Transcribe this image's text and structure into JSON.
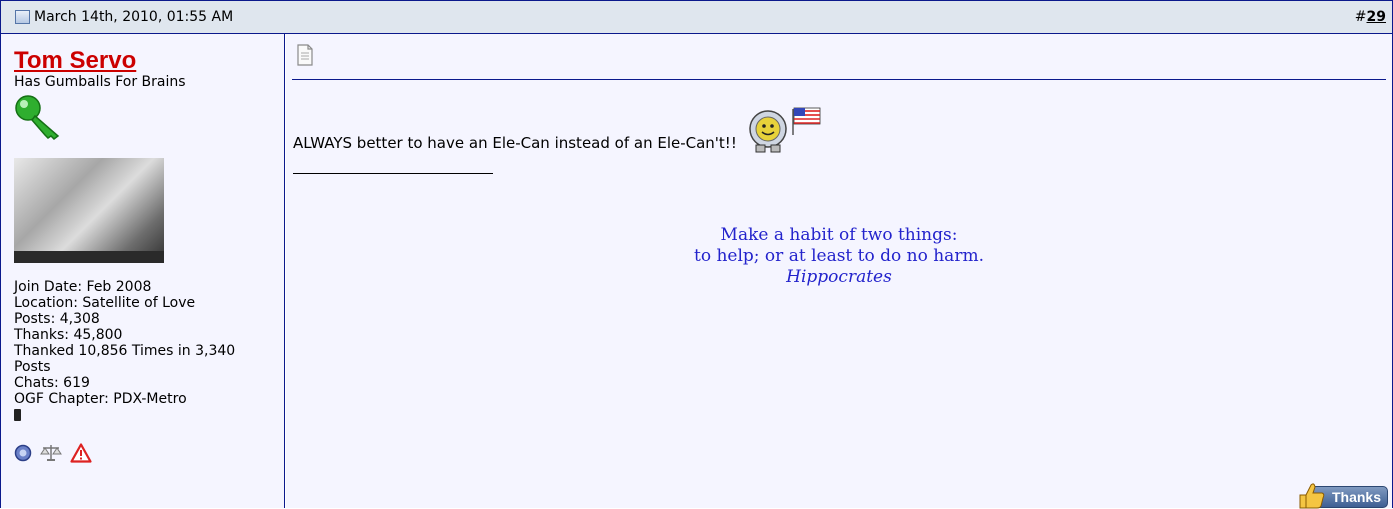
{
  "header": {
    "date": "March 14th, 2010, 01:55 AM",
    "post_number_prefix": "#",
    "post_number": "29"
  },
  "user": {
    "name": "Tom Servo",
    "title": "Has Gumballs For Brains",
    "stats": [
      "Join Date: Feb 2008",
      "Location: Satellite of Love",
      "Posts: 4,308",
      "Thanks: 45,800",
      "Thanked 10,856 Times in 3,340 Posts",
      "Chats: 619",
      "OGF Chapter: PDX-Metro"
    ]
  },
  "message": {
    "text": "ALWAYS better to have an Ele-Can instead of an Ele-Can't!!"
  },
  "signature": {
    "line1": "Make a habit of two things:",
    "line2": "to help; or at least to do no harm.",
    "author": "Hippocrates"
  },
  "actions": {
    "thanks_label": "Thanks"
  },
  "colors": {
    "username": "#cc0000",
    "quote": "#2323cc",
    "header_bg": "#dfe6ee",
    "border": "#0b198c"
  }
}
